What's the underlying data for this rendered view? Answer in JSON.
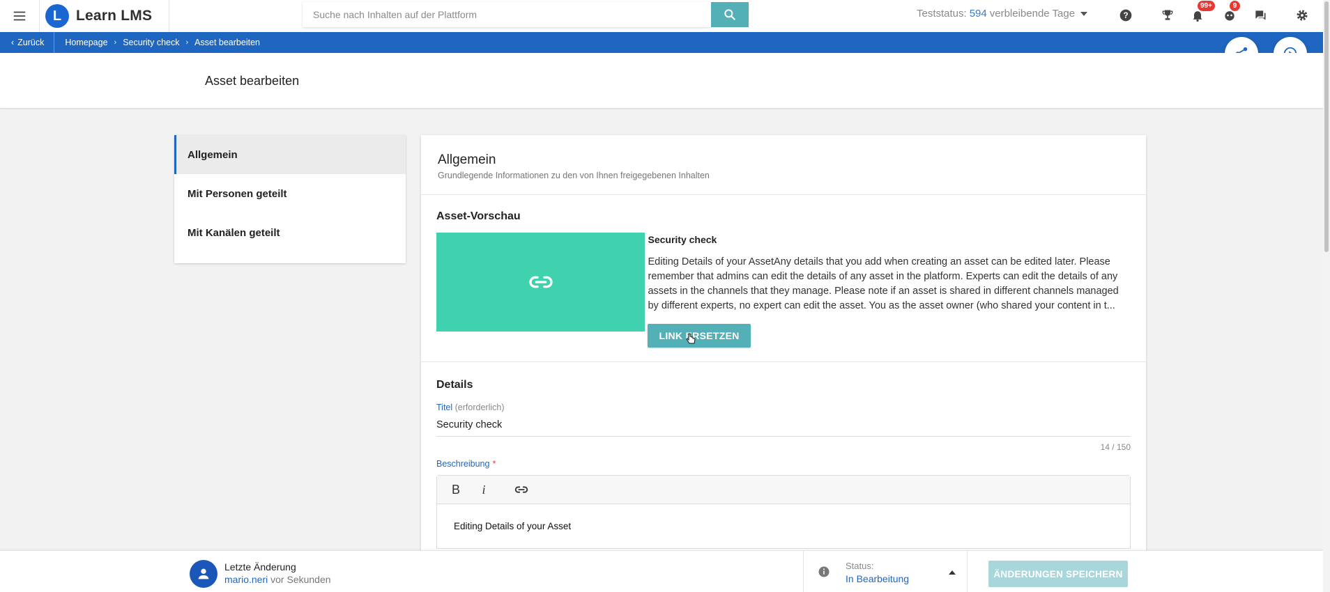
{
  "topbar": {
    "brand_name": "Learn LMS",
    "search_placeholder": "Suche nach Inhalten auf der Plattform",
    "trial_label": "Teststatus:",
    "trial_days": "594",
    "trial_suffix": "verbleibende Tage",
    "notifications_badge": "99+",
    "tasks_badge": "9"
  },
  "breadcrumb": {
    "back": "Zurück",
    "items": [
      "Homepage",
      "Security check",
      "Asset bearbeiten"
    ]
  },
  "page": {
    "title": "Asset bearbeiten"
  },
  "leftnav": {
    "items": [
      "Allgemein",
      "Mit Personen geteilt",
      "Mit Kanälen geteilt"
    ]
  },
  "card": {
    "title": "Allgemein",
    "subtitle": "Grundlegende Informationen zu den von Ihnen freigegebenen Inhalten",
    "preview": {
      "section_title": "Asset-Vorschau",
      "asset_title": "Security check",
      "description": "Editing Details of your AssetAny details that you add when creating an asset can be edited later. Please remember that admins can edit the details of any asset in the platform. Experts can edit the details of any assets in the channels that they manage. Please note if an asset is shared in different channels managed by different experts, no expert can edit the asset. You as the asset owner (who shared your content in t...",
      "replace_button": "LINK ERSETZEN"
    },
    "details": {
      "section_title": "Details",
      "title_label": "Titel",
      "title_required": "(erforderlich)",
      "title_value": "Security check",
      "title_counter": "14 / 150",
      "desc_label": "Beschreibung",
      "desc_star": "*",
      "editor_bold": "B",
      "editor_italic": "i",
      "editor_content": "Editing Details of your Asset"
    }
  },
  "bottombar": {
    "last_change_label": "Letzte Änderung",
    "user": "mario.neri",
    "ago": "vor Sekunden",
    "status_label": "Status:",
    "status_value": "In Bearbeitung",
    "save_button": "ÄNDERUNGEN SPEICHERN"
  },
  "colors": {
    "primary_blue": "#1f66c0",
    "teal": "#53b0b6",
    "thumbnail": "#40d1ae",
    "badge_red": "#e53935"
  }
}
